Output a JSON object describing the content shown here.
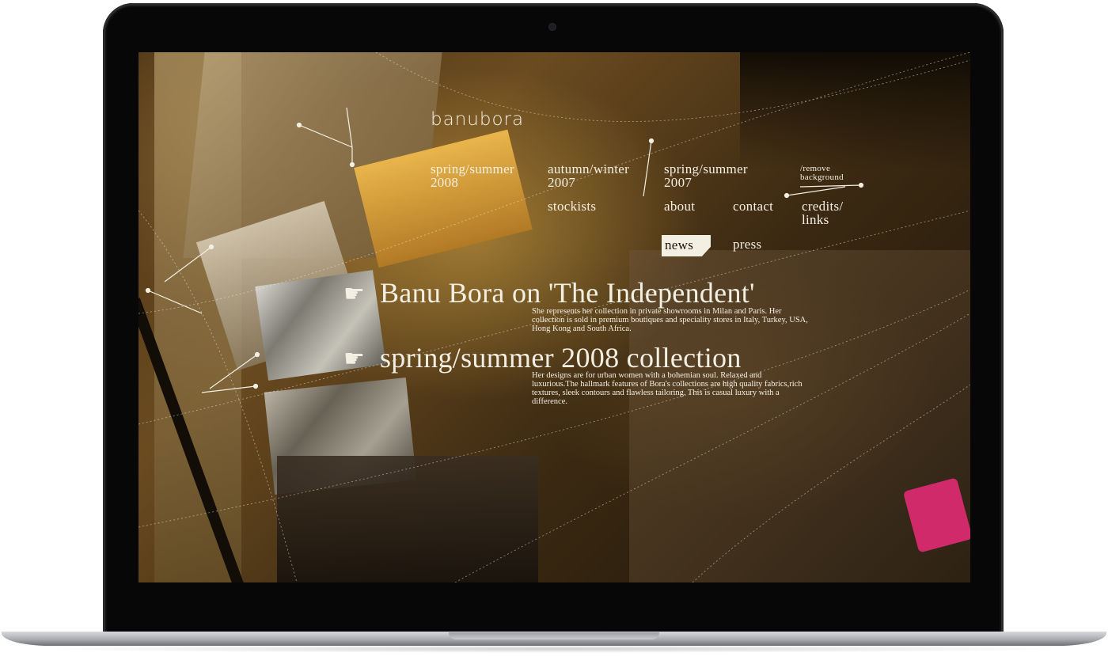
{
  "site": {
    "logo": "banubora"
  },
  "nav": {
    "collections": [
      {
        "line1": "spring/summer",
        "line2": "2008"
      },
      {
        "line1": "autumn/winter",
        "line2": "2007"
      },
      {
        "line1": "spring/summer",
        "line2": "2007"
      }
    ],
    "remove_background": {
      "line1": "/remove",
      "line2": "background"
    },
    "stockists": "stockists",
    "about": "about",
    "contact": "contact",
    "credits": {
      "line1": "credits/",
      "line2": "links"
    },
    "news": "news",
    "press": "press"
  },
  "news_items": [
    {
      "icon": "pointing-hand-icon",
      "title": "Banu Bora on 'The Independent'",
      "body": "She represents her collection in private showrooms in Milan and Paris. Her collection is sold in premium boutiques and speciality stores in Italy, Turkey, USA, Hong Kong and South Africa."
    },
    {
      "icon": "pointing-hand-icon",
      "title": "spring/summer 2008 collection",
      "body": "Her designs are for urban women with a bohemian soul. Relaxed and luxurious.The hallmark features of Bora's collections are high quality fabrics,rich textures, sleek contours and flawless tailoring. This is casual luxury with a difference."
    }
  ],
  "colors": {
    "text": "#f4efe3",
    "bezel": "#070707",
    "accent_warm": "#b27a25"
  }
}
